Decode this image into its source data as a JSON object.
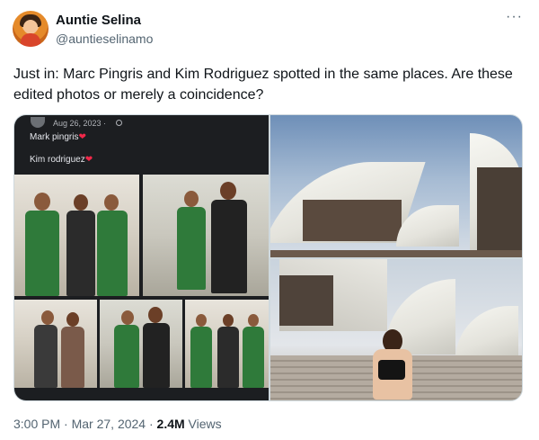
{
  "author": {
    "name": "Auntie Selina",
    "handle": "@auntieselinamo",
    "avatar_icon": "profile-photo-avatar"
  },
  "menu": {
    "more_label": "···"
  },
  "tweet": {
    "text": "Just in: Marc Pingris and Kim Rodriguez spotted in the same places. Are these edited photos or merely a coincidence?"
  },
  "media": {
    "left_screenshot": {
      "date": "Aug 26, 2023 · ",
      "line1": "Mark pingris",
      "line2": "Kim rodriguez",
      "heart_icon": "red-heart-emoji"
    }
  },
  "footer": {
    "time": "3:00 PM",
    "separator1": " · ",
    "date": "Mar 27, 2024",
    "separator2": " · ",
    "views_count": "2.4M",
    "views_label": " Views"
  },
  "colors": {
    "text_primary": "#0f1419",
    "text_secondary": "#536471",
    "border": "#cfd9de",
    "heart": "#f02849"
  }
}
